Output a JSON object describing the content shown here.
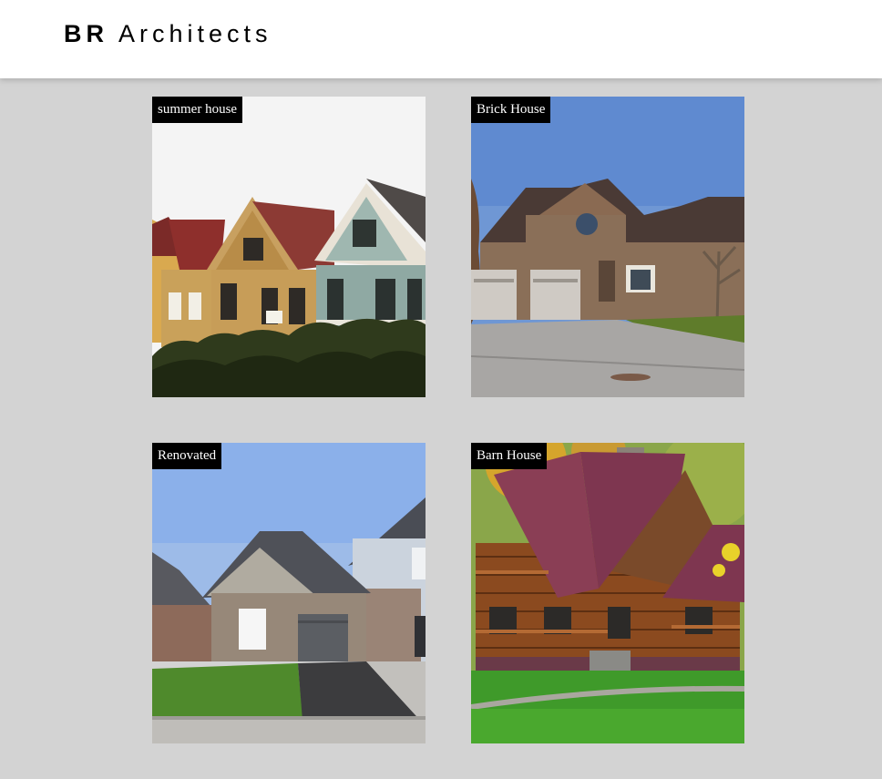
{
  "header": {
    "brand_initials": "BR",
    "brand_name": "Architects"
  },
  "projects": [
    {
      "label": "summer house"
    },
    {
      "label": "Brick House"
    },
    {
      "label": "Renovated"
    },
    {
      "label": "Barn House"
    }
  ],
  "colors": {
    "page_background": "#d3d3d3",
    "header_background": "#ffffff",
    "tag_background": "#000000",
    "tag_text": "#ffffff"
  }
}
